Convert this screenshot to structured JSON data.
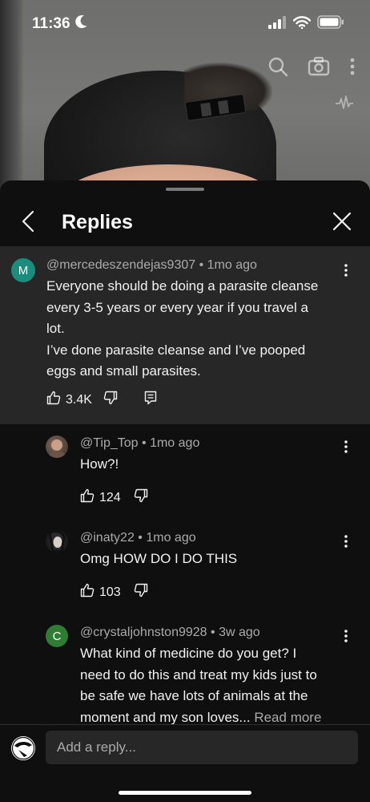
{
  "status_bar": {
    "time": "11:36"
  },
  "video_overlay": {
    "icons": [
      "search-icon",
      "camera-icon",
      "more-vert-icon",
      "waveform-icon"
    ]
  },
  "header": {
    "title": "Replies"
  },
  "parent_comment": {
    "avatar_letter": "M",
    "avatar_color": "#1c8c7d",
    "author": "@mercedeszendejas9307",
    "time": "1mo ago",
    "lines": [
      "Everyone should be doing a parasite cleanse",
      "every 3-5 years or every year if you travel a",
      "lot.",
      "I’ve done parasite cleanse and I’ve pooped",
      "eggs and small parasites."
    ],
    "likes": "3.4K"
  },
  "replies": [
    {
      "author": "@Tip_Top",
      "time": "1mo ago",
      "lines": [
        "How?!"
      ],
      "likes": "124"
    },
    {
      "author": "@inaty22",
      "time": "1mo ago",
      "lines": [
        "Omg HOW DO I DO THIS"
      ],
      "likes": "103"
    },
    {
      "avatar_letter": "C",
      "avatar_color": "#2e7d32",
      "author": "@crystaljohnston9928",
      "time": "3w ago",
      "lines": [
        "What kind of medicine do you get? I",
        "need to do this and treat my kids just to",
        "be safe we have lots of animals at the",
        "moment and my son loves..."
      ],
      "read_more": "Read more"
    }
  ],
  "reply_box": {
    "placeholder": "Add a reply..."
  },
  "colors": {
    "background": "#0f0f0f",
    "parent_background": "#272727",
    "secondary_text": "#aaaaaa"
  }
}
